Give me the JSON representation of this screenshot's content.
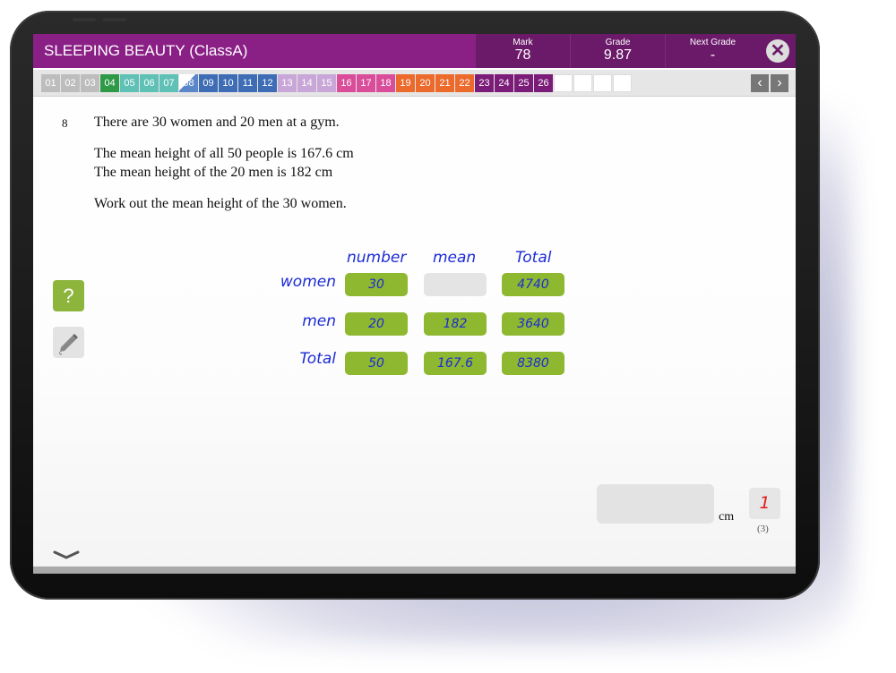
{
  "header": {
    "title": "SLEEPING BEAUTY (ClassA)",
    "stats": [
      {
        "label": "Mark",
        "value": "78"
      },
      {
        "label": "Grade",
        "value": "9.87"
      },
      {
        "label": "Next Grade",
        "value": "-"
      }
    ]
  },
  "nav": {
    "tabs": [
      {
        "label": "01",
        "color": "#bdbdbd"
      },
      {
        "label": "02",
        "color": "#bdbdbd"
      },
      {
        "label": "03",
        "color": "#bdbdbd"
      },
      {
        "label": "04",
        "color": "#2e9a47"
      },
      {
        "label": "05",
        "color": "#5fc0b6"
      },
      {
        "label": "06",
        "color": "#5fc0b6"
      },
      {
        "label": "07",
        "color": "#5fc0b6"
      },
      {
        "label": "08",
        "color": "#5b86c9"
      },
      {
        "label": "09",
        "color": "#3e6db5"
      },
      {
        "label": "10",
        "color": "#3e6db5"
      },
      {
        "label": "11",
        "color": "#3e6db5"
      },
      {
        "label": "12",
        "color": "#3e6db5"
      },
      {
        "label": "13",
        "color": "#c9a6d8"
      },
      {
        "label": "14",
        "color": "#c9a6d8"
      },
      {
        "label": "15",
        "color": "#c9a6d8"
      },
      {
        "label": "16",
        "color": "#d94d9a"
      },
      {
        "label": "17",
        "color": "#d94d9a"
      },
      {
        "label": "18",
        "color": "#d94d9a"
      },
      {
        "label": "19",
        "color": "#ec6a2c"
      },
      {
        "label": "20",
        "color": "#ec6a2c"
      },
      {
        "label": "21",
        "color": "#ec6a2c"
      },
      {
        "label": "22",
        "color": "#ec6a2c"
      },
      {
        "label": "23",
        "color": "#7a1c78"
      },
      {
        "label": "24",
        "color": "#7a1c78"
      },
      {
        "label": "25",
        "color": "#7a1c78"
      },
      {
        "label": "26",
        "color": "#7a1c78"
      }
    ],
    "prev": "‹",
    "next": "›"
  },
  "question": {
    "number": "8",
    "lines": [
      "There are 30 women and 20 men at a gym.",
      "The mean height of all 50 people is 167.6 cm",
      "The mean height of the 20 men is 182 cm",
      "Work out the mean height of the 30 women."
    ]
  },
  "table": {
    "col_headers": [
      "number",
      "mean",
      "Total"
    ],
    "row_headers": [
      "women",
      "men",
      "Total"
    ],
    "cells": [
      [
        "30",
        "",
        "4740"
      ],
      [
        "20",
        "182",
        "3640"
      ],
      [
        "50",
        "167.6",
        "8380"
      ]
    ]
  },
  "side": {
    "help": "?"
  },
  "answer": {
    "value": "",
    "unit": "cm",
    "mark": "1",
    "marks_available": "(3)"
  }
}
